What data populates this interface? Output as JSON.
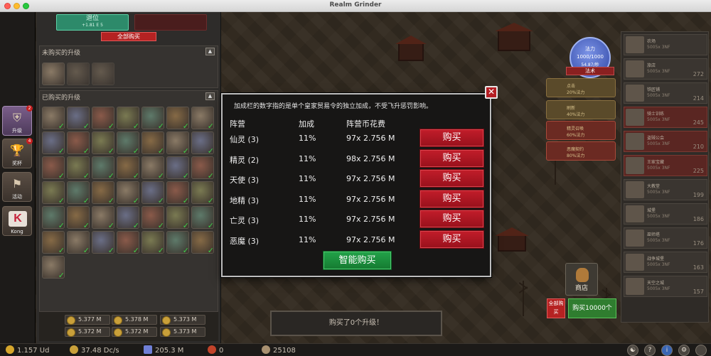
{
  "window": {
    "title": "Realm Grinder"
  },
  "categories": [
    {
      "label": "升级",
      "badge": "2",
      "glyph": "⛨"
    },
    {
      "label": "奖杯",
      "badge": "4",
      "glyph": "🏆"
    },
    {
      "label": "活动",
      "badge": "",
      "glyph": "⚑"
    },
    {
      "label": "Kong",
      "badge": "",
      "glyph": "K"
    }
  ],
  "upgrades_panel": {
    "retire_label": "退位",
    "retire_sub": "+1.81 E 5",
    "buy_all_label": "全部购买",
    "unpurchased_header": "未购买的升级",
    "purchased_header": "已购买的升级",
    "collapse_glyph": "▲",
    "coins": [
      "5.377 M",
      "5.378 M",
      "5.373 M",
      "5.372 M",
      "5.372 M",
      "5.373 M"
    ]
  },
  "mana": {
    "label": "法力",
    "value": "1000/1000",
    "regen": "54.87/秒",
    "button": "法术"
  },
  "spells": [
    {
      "name": "点击",
      "sub": "20%法力"
    },
    {
      "name": "刷新",
      "sub": "40%法力"
    },
    {
      "name": "精灵召唤",
      "sub": "60%法力"
    },
    {
      "name": "恶魔契约",
      "sub": "80%法力"
    }
  ],
  "buildings": [
    {
      "name": "农场",
      "sub": "5005x 3NF",
      "count": ""
    },
    {
      "name": "旅店",
      "sub": "5005x 3NF",
      "count": "272"
    },
    {
      "name": "铁匠铺",
      "sub": "5005x 3NF",
      "count": "214"
    },
    {
      "name": "骑士训练",
      "sub": "5005x 3NF",
      "count": "245"
    },
    {
      "name": "盗贼公会",
      "sub": "5005x 3NF",
      "count": "210"
    },
    {
      "name": "王家宝藏",
      "sub": "5005x 3NF",
      "count": "225"
    },
    {
      "name": "大教堂",
      "sub": "5005x 3NF",
      "count": "199"
    },
    {
      "name": "城堡",
      "sub": "5005x 3NF",
      "count": "186"
    },
    {
      "name": "巫师塔",
      "sub": "5005x 3NF",
      "count": "176"
    },
    {
      "name": "战争城堡",
      "sub": "5005x 3NF",
      "count": "163"
    },
    {
      "name": "天空之城",
      "sub": "5005x 3NF",
      "count": "157"
    }
  ],
  "shop": {
    "label": "商店"
  },
  "buy_all_side": "全部购买",
  "buy_10000": "购买10000个",
  "message": "购买了0个升级！",
  "status": {
    "gold": "1.157 Ud",
    "dcs": "37.48 Dc/s",
    "gems": "205.3 M",
    "rubies": "0",
    "score": "25108"
  },
  "status_buttons": [
    "☯",
    "?",
    "i",
    "⚙"
  ],
  "modal": {
    "note": "加成栏的数字指的是单个皇家贸易令的独立加成，不受飞升惩罚影响。",
    "headers": {
      "faction": "阵营",
      "bonus": "加成",
      "cost": "阵营币花费"
    },
    "rows": [
      {
        "faction": "仙灵 (3)",
        "bonus": "11%",
        "cost": "97x 2.756 M",
        "button": "购买"
      },
      {
        "faction": "精灵 (2)",
        "bonus": "11%",
        "cost": "98x 2.756 M",
        "button": "购买"
      },
      {
        "faction": "天使 (3)",
        "bonus": "11%",
        "cost": "97x 2.756 M",
        "button": "购买"
      },
      {
        "faction": "地精 (3)",
        "bonus": "11%",
        "cost": "97x 2.756 M",
        "button": "购买"
      },
      {
        "faction": "亡灵 (3)",
        "bonus": "11%",
        "cost": "97x 2.756 M",
        "button": "购买"
      },
      {
        "faction": "恶魔 (3)",
        "bonus": "11%",
        "cost": "97x 2.756 M",
        "button": "购买"
      }
    ],
    "smart_buy": "智能购买",
    "close_glyph": "✕"
  }
}
